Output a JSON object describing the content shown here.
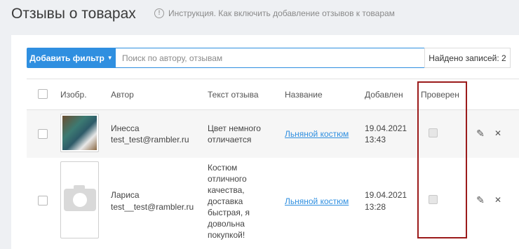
{
  "page": {
    "title": "Отзывы о товарах",
    "help_text": "Инструкция. Как включить добавление отзывов к товарам",
    "help_icon": "info-circle-icon"
  },
  "toolbar": {
    "add_filter_label": "Добавить фильтр",
    "search_placeholder": "Поиск по автору, отзывам",
    "search_value": "",
    "found_label": "Найдено записей: 2"
  },
  "table": {
    "headers": {
      "image": "Изобр.",
      "author": "Автор",
      "text": "Текст отзыва",
      "name": "Название",
      "added": "Добавлен",
      "checked": "Проверен"
    },
    "rows": [
      {
        "image": "product-photo",
        "author_name": "Инесса",
        "author_email": "test_test@rambler.ru",
        "text_lines": [
          "Цвет немного",
          "отличается"
        ],
        "product": "Льняной костюм",
        "date": "19.04.2021",
        "time": "13:43",
        "checked": false
      },
      {
        "image": "camera-placeholder",
        "author_name": "Лариса",
        "author_email": "test__test@rambler.ru",
        "text_lines": [
          "Костюм",
          "отличного",
          "качества,",
          "доставка",
          "быстрая, я",
          "довольна",
          "покупкой!"
        ],
        "product": "Льняной костюм",
        "date": "19.04.2021",
        "time": "13:28",
        "checked": false
      }
    ]
  },
  "colors": {
    "accent": "#2f8fe0",
    "highlight": "#9b1b1b"
  }
}
